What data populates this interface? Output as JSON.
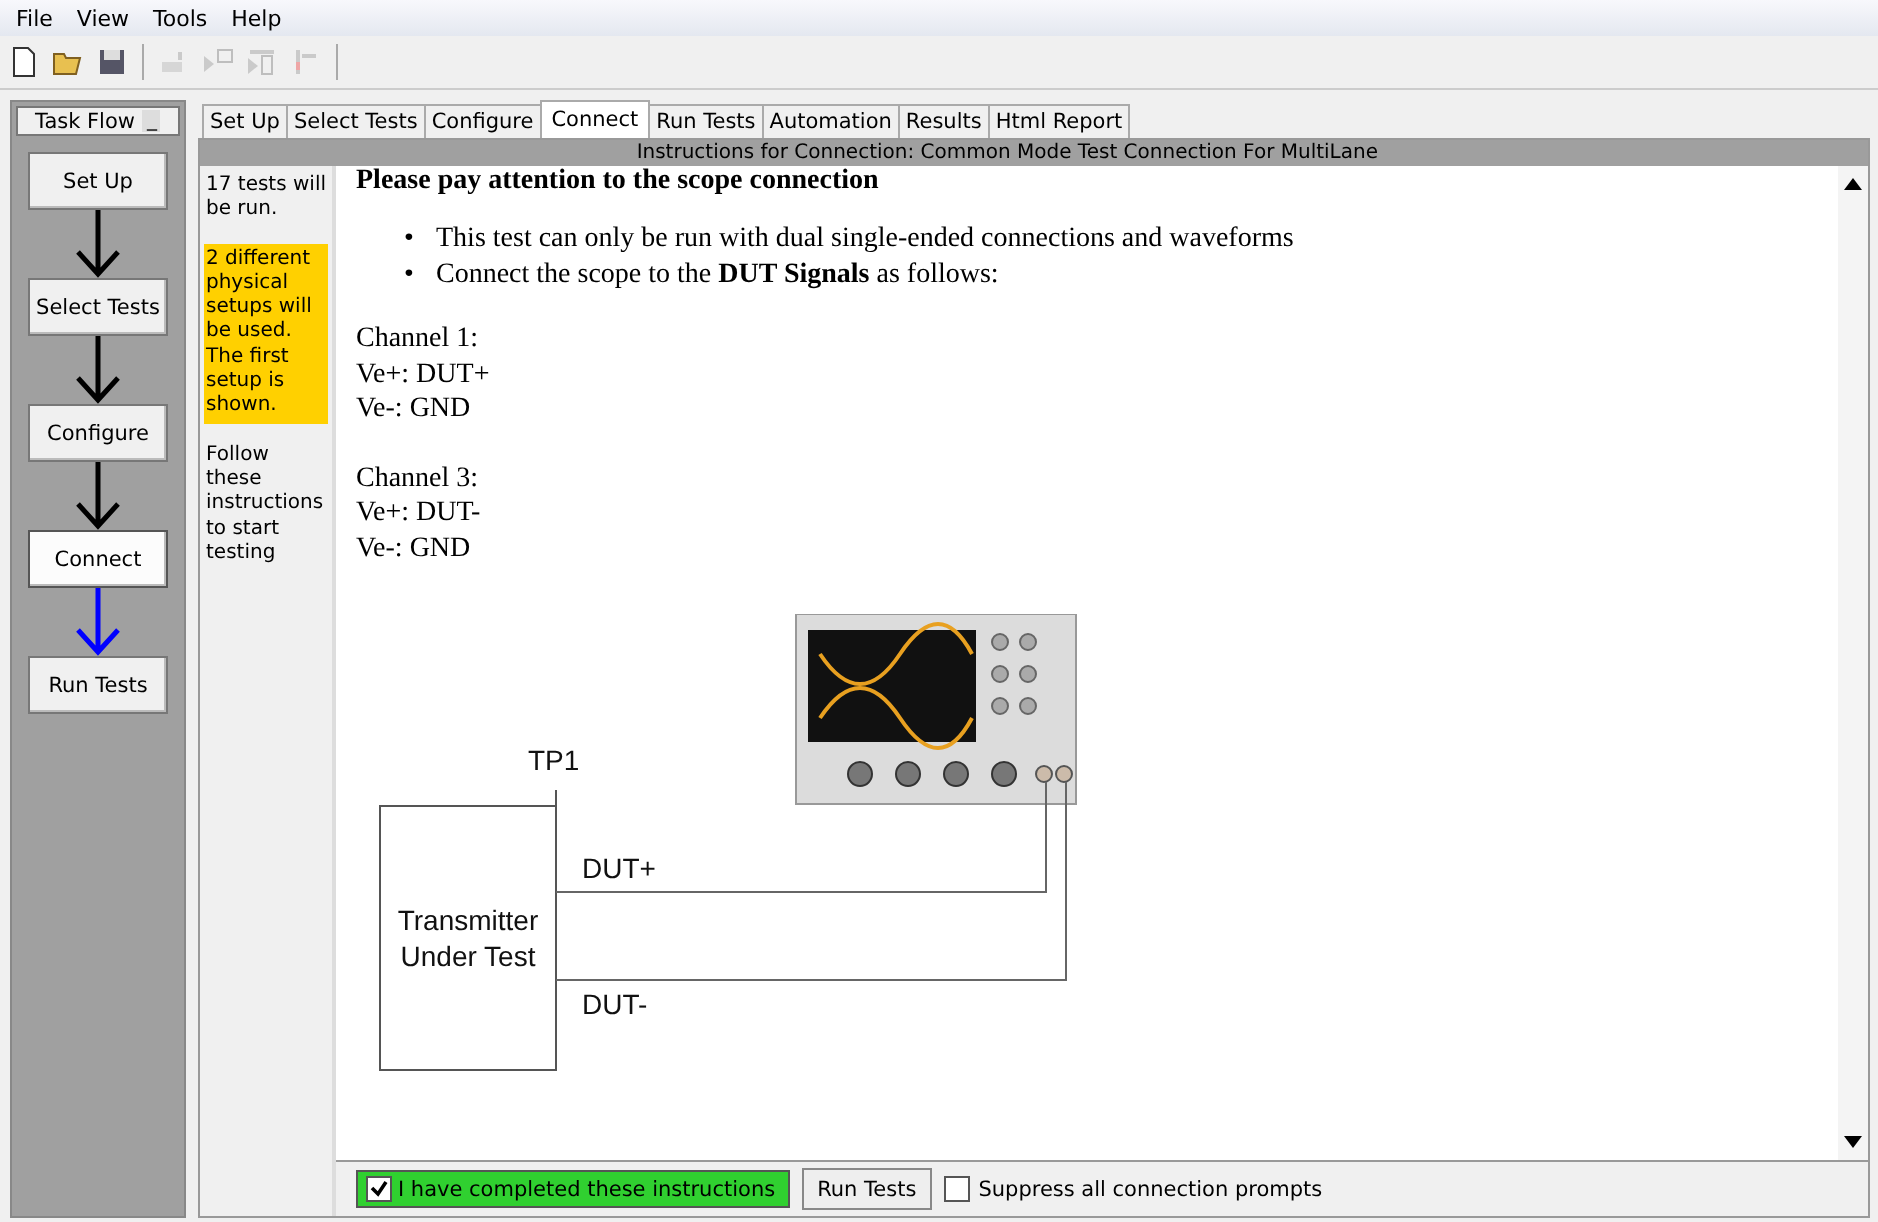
{
  "menu": [
    "File",
    "View",
    "Tools",
    "Help"
  ],
  "toolbar": [
    {
      "kind": "new",
      "disabled": false
    },
    {
      "kind": "open",
      "disabled": false
    },
    {
      "kind": "save",
      "disabled": false
    },
    {
      "kind": "sep"
    },
    {
      "kind": "tool-a",
      "disabled": true
    },
    {
      "kind": "tool-b",
      "disabled": true
    },
    {
      "kind": "tool-c",
      "disabled": true
    },
    {
      "kind": "tool-d",
      "disabled": true
    },
    {
      "kind": "sep"
    }
  ],
  "task_flow": {
    "title": "Task Flow",
    "minimize": "_",
    "steps": [
      {
        "label": "Set Up",
        "selected": false
      },
      {
        "label": "Select Tests",
        "selected": false
      },
      {
        "label": "Configure",
        "selected": false
      },
      {
        "label": "Connect",
        "selected": true
      },
      {
        "label": "Run Tests",
        "selected": false
      }
    ]
  },
  "tabs": [
    {
      "label": "Set Up",
      "selected": false
    },
    {
      "label": "Select Tests",
      "selected": false
    },
    {
      "label": "Configure",
      "selected": false
    },
    {
      "label": "Connect",
      "selected": true
    },
    {
      "label": "Run Tests",
      "selected": false
    },
    {
      "label": "Automation",
      "selected": false
    },
    {
      "label": "Results",
      "selected": false
    },
    {
      "label": "Html Report",
      "selected": false
    }
  ],
  "panel_title": "Instructions for Connection: Common Mode Test Connection For MultiLane",
  "notes": [
    {
      "text": "17 tests will be run.",
      "highlighted": false
    },
    {
      "text": "2 different physical setups will be used. The first setup is shown.",
      "highlighted": true
    },
    {
      "text": "Follow these instructions to start testing",
      "highlighted": false
    }
  ],
  "instructions": {
    "heading": "Please pay attention to the scope connection",
    "bullet_marker": "•",
    "bullets": [
      "This test can only be run with dual single-ended connections and waveforms",
      "Connect the scope to the **DUT Signals** as follows:"
    ],
    "channels": [
      {
        "title": "Channel 1:",
        "lines": [
          "Ve+: DUT+",
          "Ve-: GND"
        ]
      },
      {
        "title": "Channel 3:",
        "lines": [
          "Ve+: DUT-",
          "Ve-: GND"
        ]
      }
    ]
  },
  "diagram": {
    "test_point": "TP1",
    "device": [
      "Transmitter",
      "Under Test"
    ],
    "signal_plus": "DUT+",
    "signal_minus": "DUT-"
  },
  "bottom_bar": {
    "completed": {
      "label": "I have completed these instructions",
      "checked": true
    },
    "run_button": "Run Tests",
    "suppress": {
      "label": "Suppress all connection prompts",
      "checked": false
    }
  }
}
